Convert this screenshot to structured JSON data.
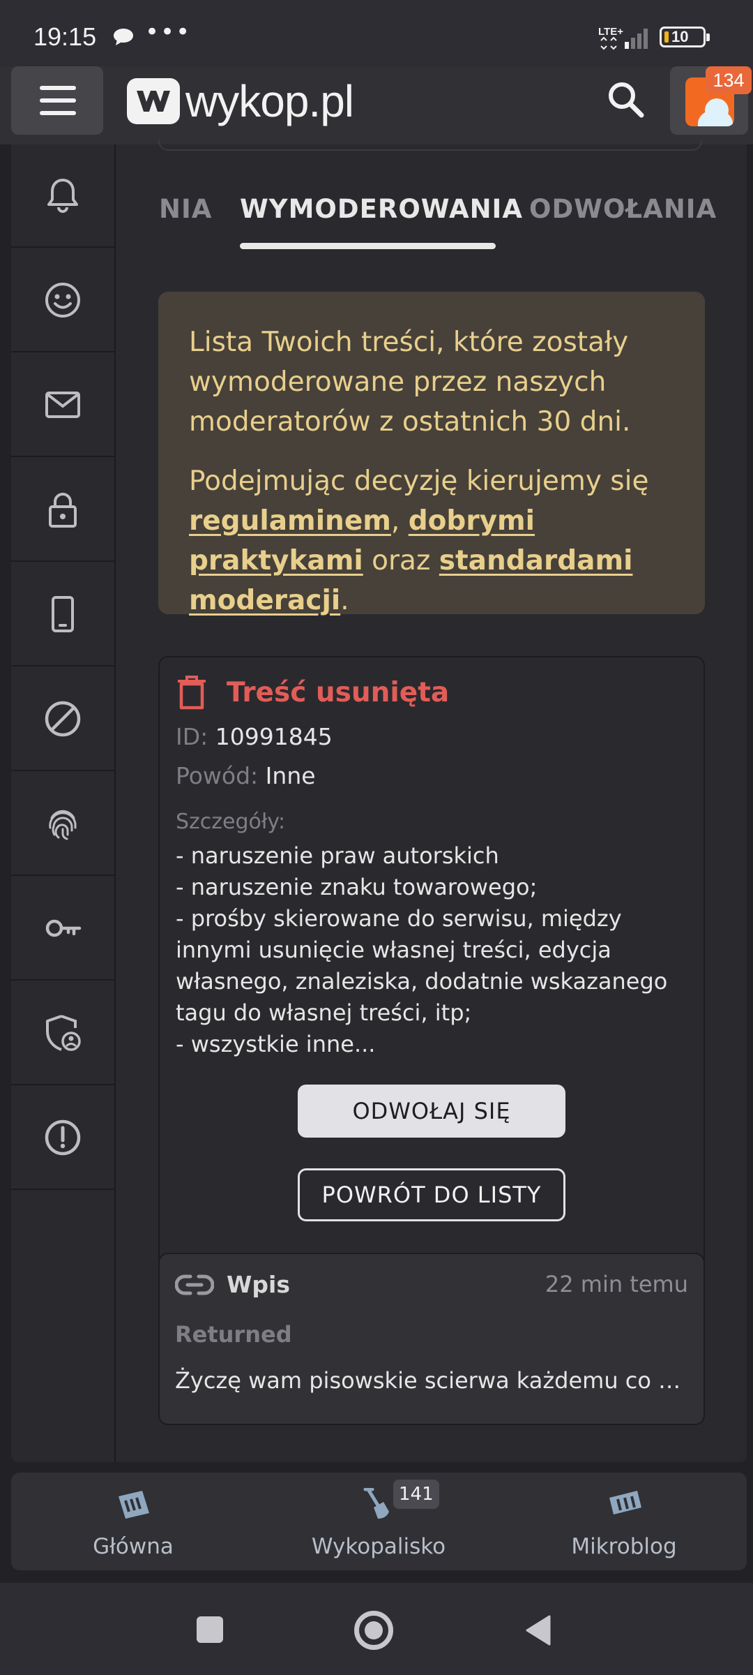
{
  "status_bar": {
    "time": "19:15",
    "dots": "•••",
    "network": "LTE+",
    "battery": "10"
  },
  "app_bar": {
    "logo_text": "wykop.pl",
    "notifications_badge": "134"
  },
  "sidebar": {
    "items": [
      {
        "icon": "bell-icon"
      },
      {
        "icon": "smiley-icon"
      },
      {
        "icon": "mail-icon"
      },
      {
        "icon": "lock-icon"
      },
      {
        "icon": "phone-icon"
      },
      {
        "icon": "block-icon"
      },
      {
        "icon": "fingerprint-icon"
      },
      {
        "icon": "key-icon"
      },
      {
        "icon": "shield-user-icon"
      },
      {
        "icon": "alert-icon"
      }
    ]
  },
  "tabs": {
    "items": [
      {
        "label": "NIA"
      },
      {
        "label": "WYMODEROWANIA"
      },
      {
        "label": "ODWOŁANIA"
      }
    ],
    "active": "WYMODEROWANIA"
  },
  "info": {
    "text1": "Lista Twoich treści, które zostały wymoderowane przez naszych moderatorów z ostatnich 30 dni.",
    "text2_prefix": "Podejmując decyzję kierujemy się ",
    "link1": "regulaminem",
    "sep1": ", ",
    "link2": "dobrymi praktykami",
    "sep2": " oraz ",
    "link3": "standardami moderacji",
    "suffix": "."
  },
  "moderation": {
    "title": "Treść usunięta",
    "id_label": "ID:",
    "id_value": "10991845",
    "reason_label": "Powód:",
    "reason_value": "Inne",
    "details_label": "Szczegóły:",
    "details_text": "- naruszenie praw autorskich\n- naruszenie znaku towarowego;\n- prośby skierowane do serwisu, między innymi usunięcie własnej treści, edycja własnego, znaleziska, dodatnie wskazanego tagu do własnej treści, itp;\n- wszystkie inne...",
    "appeal_button": "ODWOŁAJ SIĘ",
    "back_button": "POWRÓT DO LISTY",
    "entry": {
      "type": "Wpis",
      "time": "22 min temu",
      "status": "Returned",
      "excerpt": "Życzę wam pisowskie scierwa każdemu co do j..."
    }
  },
  "bottom_nav": {
    "items": [
      {
        "label": "Główna"
      },
      {
        "label": "Wykopalisko",
        "badge": "141"
      },
      {
        "label": "Mikroblog"
      }
    ]
  },
  "colors": {
    "accent_red": "#e25d58",
    "info_text": "#e8cf8c",
    "info_bg": "#47413a",
    "badge_orange": "#e8683a"
  }
}
